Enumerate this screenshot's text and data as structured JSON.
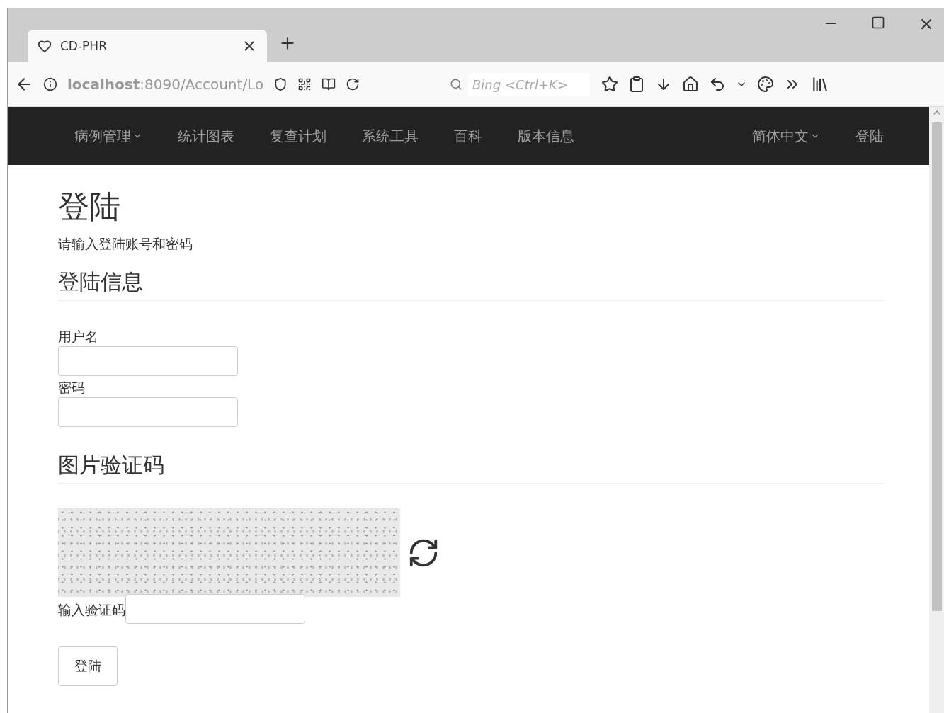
{
  "browser": {
    "tab": {
      "title": "CD-PHR"
    },
    "address": "**localhost**:8090/Account/Lo",
    "search": {
      "placeholder": "Bing <Ctrl+K>"
    }
  },
  "navbar": {
    "items": [
      {
        "label": "病例管理",
        "dropdown": true
      },
      {
        "label": "统计图表",
        "dropdown": false
      },
      {
        "label": "复查计划",
        "dropdown": false
      },
      {
        "label": "系统工具",
        "dropdown": false
      },
      {
        "label": "百科",
        "dropdown": false
      },
      {
        "label": "版本信息",
        "dropdown": false
      }
    ],
    "right_items": [
      {
        "label": "简体中文",
        "dropdown": true
      },
      {
        "label": "登陆",
        "dropdown": false
      }
    ]
  },
  "page": {
    "title": "登陆",
    "subtitle": "请输入登陆账号和密码",
    "login_section": {
      "heading": "登陆信息",
      "fields": [
        {
          "label": "用户名"
        },
        {
          "label": "密码"
        }
      ]
    },
    "captcha_section": {
      "heading": "图片验证码",
      "input_label": "输入验证码"
    },
    "submit": "登陆"
  }
}
